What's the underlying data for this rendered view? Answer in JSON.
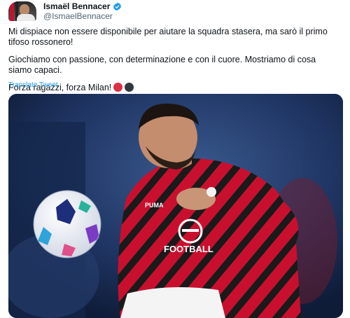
{
  "tweet": {
    "author": {
      "display_name": "Ismaël Bennacer",
      "handle": "@IsmaelBennacer"
    },
    "text": {
      "paragraph_1": "Mi dispiace non essere disponibile per aiutare la squadra stasera, ma sarò il primo tifoso rossonero!",
      "paragraph_2": "Giochiamo con passione, con determinazione e con il cuore. Mostriamo di cosa siamo capaci.",
      "paragraph_3": "Forza ragazzi, forza Milan!"
    },
    "emojis": [
      "red-circle",
      "black-circle"
    ],
    "translate_label": "Translate Tweet",
    "media": {
      "shirt_sponsor": "FOOTBALL",
      "shirt_brand": "PUMA"
    }
  },
  "colors": {
    "verified": "#1d9bf0",
    "link": "#1d9bf0",
    "red_circle": "#dd2e44",
    "black_circle": "#31373d",
    "milan_red": "#c8102e"
  }
}
